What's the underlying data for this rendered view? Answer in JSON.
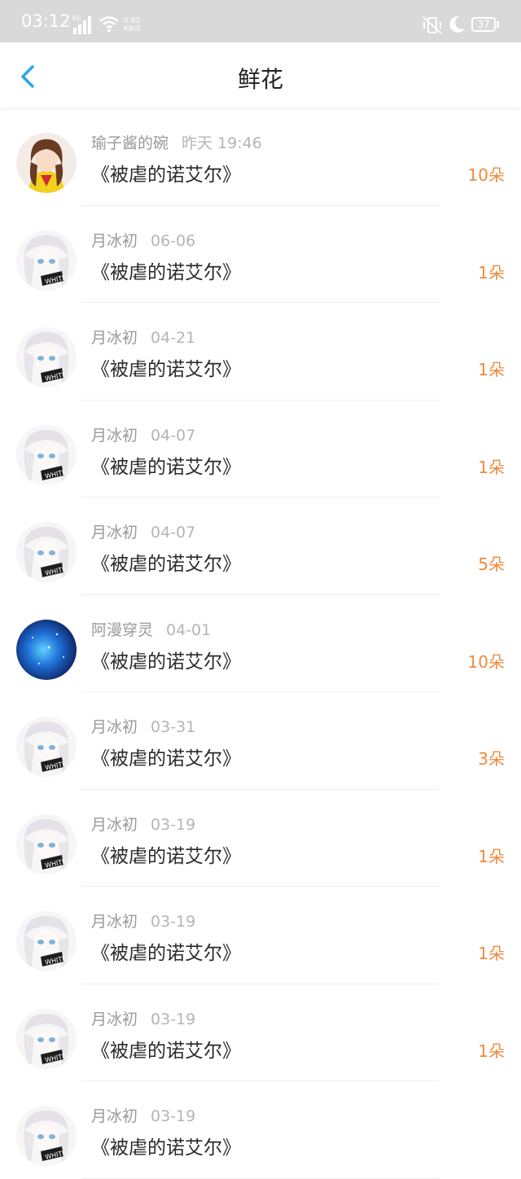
{
  "status_bar": {
    "time": "03:12",
    "network": "4G",
    "speed_value": "0.83",
    "speed_unit": "KB/S",
    "battery": "37"
  },
  "header": {
    "title": "鲜花"
  },
  "colors": {
    "accent_blue": "#2aa6e6",
    "count_orange": "#f08a3c",
    "status_bar_bg": "#d9d9d9"
  },
  "items": [
    {
      "user": "瑜子酱的碗",
      "time": "昨天 19:46",
      "book": "《被虐的诺艾尔》",
      "count": "10朵",
      "avatar": "anime-girl-avatar"
    },
    {
      "user": "月冰初",
      "time": "06-06",
      "book": "《被虐的诺艾尔》",
      "count": "1朵",
      "avatar": "white-hair-avatar"
    },
    {
      "user": "月冰初",
      "time": "04-21",
      "book": "《被虐的诺艾尔》",
      "count": "1朵",
      "avatar": "white-hair-avatar"
    },
    {
      "user": "月冰初",
      "time": "04-07",
      "book": "《被虐的诺艾尔》",
      "count": "1朵",
      "avatar": "white-hair-avatar"
    },
    {
      "user": "月冰初",
      "time": "04-07",
      "book": "《被虐的诺艾尔》",
      "count": "5朵",
      "avatar": "white-hair-avatar"
    },
    {
      "user": "阿漫穿灵",
      "time": "04-01",
      "book": "《被虐的诺艾尔》",
      "count": "10朵",
      "avatar": "galaxy-avatar"
    },
    {
      "user": "月冰初",
      "time": "03-31",
      "book": "《被虐的诺艾尔》",
      "count": "3朵",
      "avatar": "white-hair-avatar"
    },
    {
      "user": "月冰初",
      "time": "03-19",
      "book": "《被虐的诺艾尔》",
      "count": "1朵",
      "avatar": "white-hair-avatar"
    },
    {
      "user": "月冰初",
      "time": "03-19",
      "book": "《被虐的诺艾尔》",
      "count": "1朵",
      "avatar": "white-hair-avatar"
    },
    {
      "user": "月冰初",
      "time": "03-19",
      "book": "《被虐的诺艾尔》",
      "count": "1朵",
      "avatar": "white-hair-avatar"
    },
    {
      "user": "月冰初",
      "time": "03-19",
      "book": "《被虐的诺艾尔》",
      "count": "",
      "avatar": "white-hair-avatar"
    }
  ]
}
